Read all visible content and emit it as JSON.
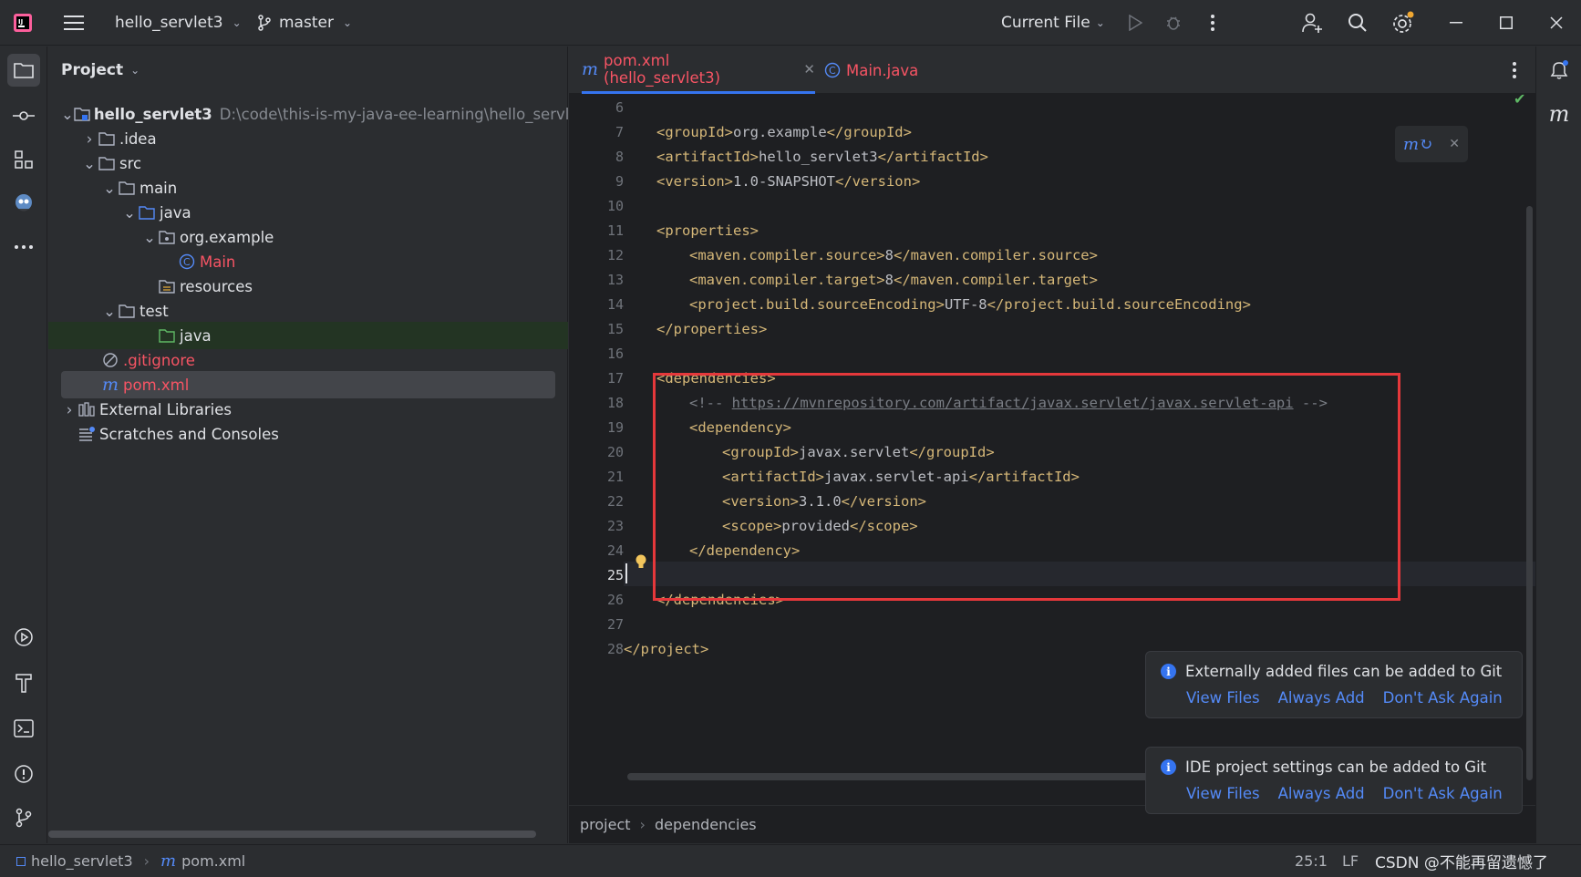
{
  "titlebar": {
    "project_name": "hello_servlet3",
    "branch": "master",
    "run_config": "Current File",
    "colors": {
      "accent": "#3574f0",
      "warning_dot": "#f0a732"
    }
  },
  "left_toolbar": {
    "icons": [
      "folder-icon",
      "commit-icon",
      "structure-icon",
      "plugin-icon",
      "more-icon",
      "run-icon",
      "build-icon",
      "terminal-icon",
      "problems-icon",
      "git-icon"
    ]
  },
  "project_panel": {
    "title": "Project",
    "tree": [
      {
        "label": "hello_servlet3",
        "path": "D:\\code\\this-is-my-java-ee-learning\\hello_servlet",
        "icon": "module-folder-icon"
      },
      {
        "label": ".idea",
        "icon": "folder-icon"
      },
      {
        "label": "src",
        "icon": "folder-icon"
      },
      {
        "label": "main",
        "icon": "folder-icon"
      },
      {
        "label": "java",
        "icon": "source-folder-icon"
      },
      {
        "label": "org.example",
        "icon": "package-icon"
      },
      {
        "label": "Main",
        "icon": "class-icon"
      },
      {
        "label": "resources",
        "icon": "resources-folder-icon"
      },
      {
        "label": "test",
        "icon": "folder-icon"
      },
      {
        "label": "java",
        "icon": "test-folder-icon"
      },
      {
        "label": ".gitignore",
        "icon": "ignored-file-icon"
      },
      {
        "label": "pom.xml",
        "icon": "maven-icon"
      },
      {
        "label": "External Libraries",
        "icon": "libraries-icon"
      },
      {
        "label": "Scratches and Consoles",
        "icon": "scratches-icon"
      }
    ]
  },
  "tabs": [
    {
      "label": "pom.xml (hello_servlet3)",
      "icon": "maven-icon",
      "active": true
    },
    {
      "label": "Main.java",
      "icon": "class-icon",
      "active": false
    }
  ],
  "editor": {
    "lines": [
      {
        "n": "6",
        "indent": 0,
        "text": ""
      },
      {
        "n": "7",
        "indent": 1,
        "open": "<groupId>",
        "val": "org.example",
        "close": "</groupId>"
      },
      {
        "n": "8",
        "indent": 1,
        "open": "<artifactId>",
        "val": "hello_servlet3",
        "close": "</artifactId>"
      },
      {
        "n": "9",
        "indent": 1,
        "open": "<version>",
        "val": "1.0-SNAPSHOT",
        "close": "</version>"
      },
      {
        "n": "10",
        "indent": 0,
        "text": ""
      },
      {
        "n": "11",
        "indent": 1,
        "open": "<properties>"
      },
      {
        "n": "12",
        "indent": 2,
        "open": "<maven.compiler.source>",
        "val": "8",
        "close": "</maven.compiler.source>"
      },
      {
        "n": "13",
        "indent": 2,
        "open": "<maven.compiler.target>",
        "val": "8",
        "close": "</maven.compiler.target>"
      },
      {
        "n": "14",
        "indent": 2,
        "open": "<project.build.sourceEncoding>",
        "val": "UTF-8",
        "close": "</project.build.sourceEncoding>"
      },
      {
        "n": "15",
        "indent": 1,
        "open": "</properties>"
      },
      {
        "n": "16",
        "indent": 0,
        "text": ""
      },
      {
        "n": "17",
        "indent": 1,
        "open": "<dependencies>"
      },
      {
        "n": "18",
        "indent": 2,
        "comment_start": "<!-- ",
        "link": "https://mvnrepository.com/artifact/javax.servlet/javax.servlet-api",
        "comment_end": " -->"
      },
      {
        "n": "19",
        "indent": 2,
        "open": "<dependency>"
      },
      {
        "n": "20",
        "indent": 3,
        "open": "<groupId>",
        "val": "javax.servlet",
        "close": "</groupId>"
      },
      {
        "n": "21",
        "indent": 3,
        "open": "<artifactId>",
        "val": "javax.servlet-api",
        "close": "</artifactId>"
      },
      {
        "n": "22",
        "indent": 3,
        "open": "<version>",
        "val": "3.1.0",
        "close": "</version>"
      },
      {
        "n": "23",
        "indent": 3,
        "open": "<scope>",
        "val": "provided",
        "close": "</scope>"
      },
      {
        "n": "24",
        "indent": 2,
        "open": "</dependency>"
      },
      {
        "n": "25",
        "indent": 0,
        "text": "",
        "current": true
      },
      {
        "n": "26",
        "indent": 1,
        "open": "</dependencies>"
      },
      {
        "n": "27",
        "indent": 0,
        "text": ""
      },
      {
        "n": "28",
        "indent": 0,
        "open": "</project>"
      }
    ],
    "highlight_color": "#e5383b"
  },
  "breadcrumbs": [
    "project",
    "dependencies"
  ],
  "notifications": [
    {
      "title": "Externally added files can be added to Git",
      "actions": [
        "View Files",
        "Always Add",
        "Don't Ask Again"
      ]
    },
    {
      "title": "IDE project settings can be added to Git",
      "actions": [
        "View Files",
        "Always Add",
        "Don't Ask Again"
      ]
    }
  ],
  "statusbar": {
    "project": "hello_servlet3",
    "file": "pom.xml",
    "position": "25:1",
    "line_ending": "LF",
    "watermark": "CSDN @不能再留遗憾了"
  }
}
